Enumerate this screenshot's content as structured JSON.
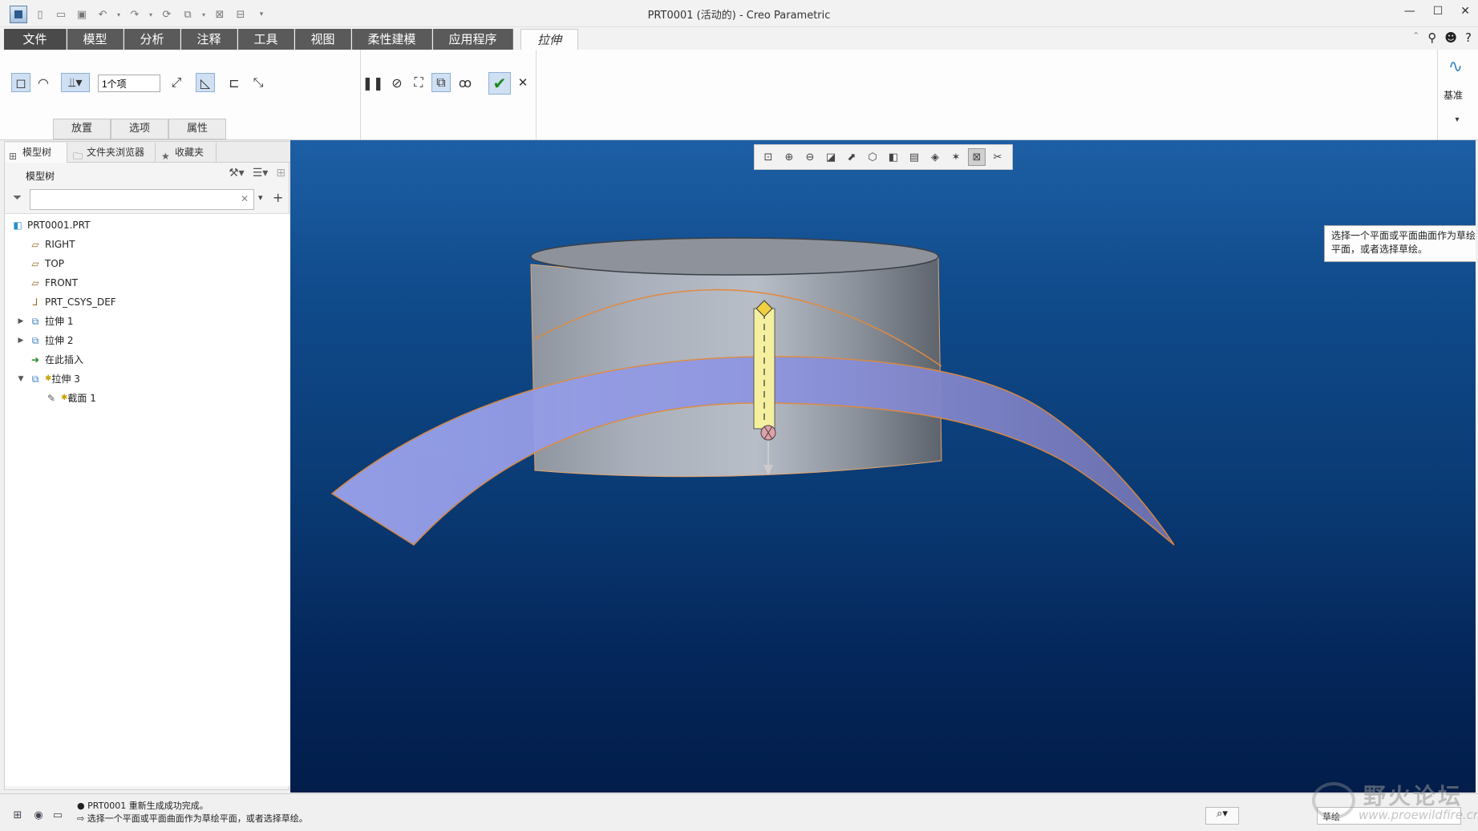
{
  "window": {
    "title": "PRT0001 (活动的) - Creo Parametric",
    "controls": [
      "minimize",
      "maximize",
      "close"
    ]
  },
  "ribbon_tabs": [
    {
      "label": "文件"
    },
    {
      "label": "模型"
    },
    {
      "label": "分析"
    },
    {
      "label": "注释"
    },
    {
      "label": "工具"
    },
    {
      "label": "视图"
    },
    {
      "label": "柔性建模"
    },
    {
      "label": "应用程序"
    },
    {
      "label": "拉伸"
    }
  ],
  "ribbon": {
    "depth_value": "1个项",
    "subtabs": [
      "放置",
      "选项",
      "属性"
    ],
    "datum_label": "基准"
  },
  "model_tree": {
    "tabs": [
      "模型树",
      "文件夹浏览器",
      "收藏夹"
    ],
    "header_label": "模型树",
    "filter_placeholder": "",
    "items": [
      {
        "label": "PRT0001.PRT"
      },
      {
        "label": "RIGHT"
      },
      {
        "label": "TOP"
      },
      {
        "label": "FRONT"
      },
      {
        "label": "PRT_CSYS_DEF"
      },
      {
        "label": "拉伸 1"
      },
      {
        "label": "拉伸 2"
      },
      {
        "label": "在此插入"
      },
      {
        "label": "拉伸 3"
      },
      {
        "label": "截面 1"
      }
    ]
  },
  "viewport": {
    "tooltip": "选择一个平面或平面曲面作为草绘平面，或者选择草绘。"
  },
  "status": {
    "message1": "PRT0001 重新生成成功完成。",
    "message2": "选择一个平面或平面曲面作为草绘平面，或者选择草绘。",
    "filter_value": "草绘"
  },
  "watermark": {
    "title": "野火论坛",
    "url": "www.proewildfire.cn"
  },
  "colors": {
    "tab_dark": "#5a5a5a",
    "viewport_top": "#1d5fa5",
    "viewport_bottom": "#021d4a",
    "surface": "#8f96e0",
    "cylinder": "#a9b0bb",
    "accent_yellow": "#f5f0a0"
  }
}
